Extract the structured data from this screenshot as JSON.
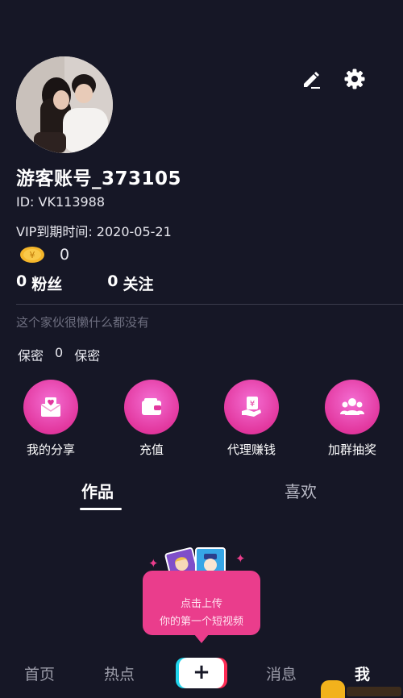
{
  "profile": {
    "username": "游客账号_373105",
    "id_text": "ID: VK113988",
    "vip_text": "VIP到期时间: 2020-05-21",
    "coins": "0",
    "fans_count": "0",
    "fans_label": "粉丝",
    "follow_count": "0",
    "follow_label": "关注",
    "bio": "这个家伙很懒什么都没有",
    "tags": [
      "保密",
      "0",
      "保密"
    ]
  },
  "icons": {
    "edit": "pencil-icon",
    "settings": "gear-icon",
    "coin": "coin-icon"
  },
  "actions": [
    {
      "label": "我的分享",
      "icon": "share-envelope-icon"
    },
    {
      "label": "充值",
      "icon": "wallet-icon"
    },
    {
      "label": "代理赚钱",
      "icon": "money-hand-icon"
    },
    {
      "label": "加群抽奖",
      "icon": "group-icon"
    }
  ],
  "tabs": {
    "works": "作品",
    "likes": "喜欢"
  },
  "upload_prompt": {
    "line1": "点击上传",
    "line2": "你的第一个短视频"
  },
  "bottom_nav": {
    "home": "首页",
    "hot": "热点",
    "plus": "+",
    "messages": "消息",
    "me": "我"
  },
  "colors": {
    "background": "#161726",
    "accent_pink": "#ea3d8c",
    "action_pink": "#e2379e",
    "coin_gold": "#f5b62a"
  }
}
